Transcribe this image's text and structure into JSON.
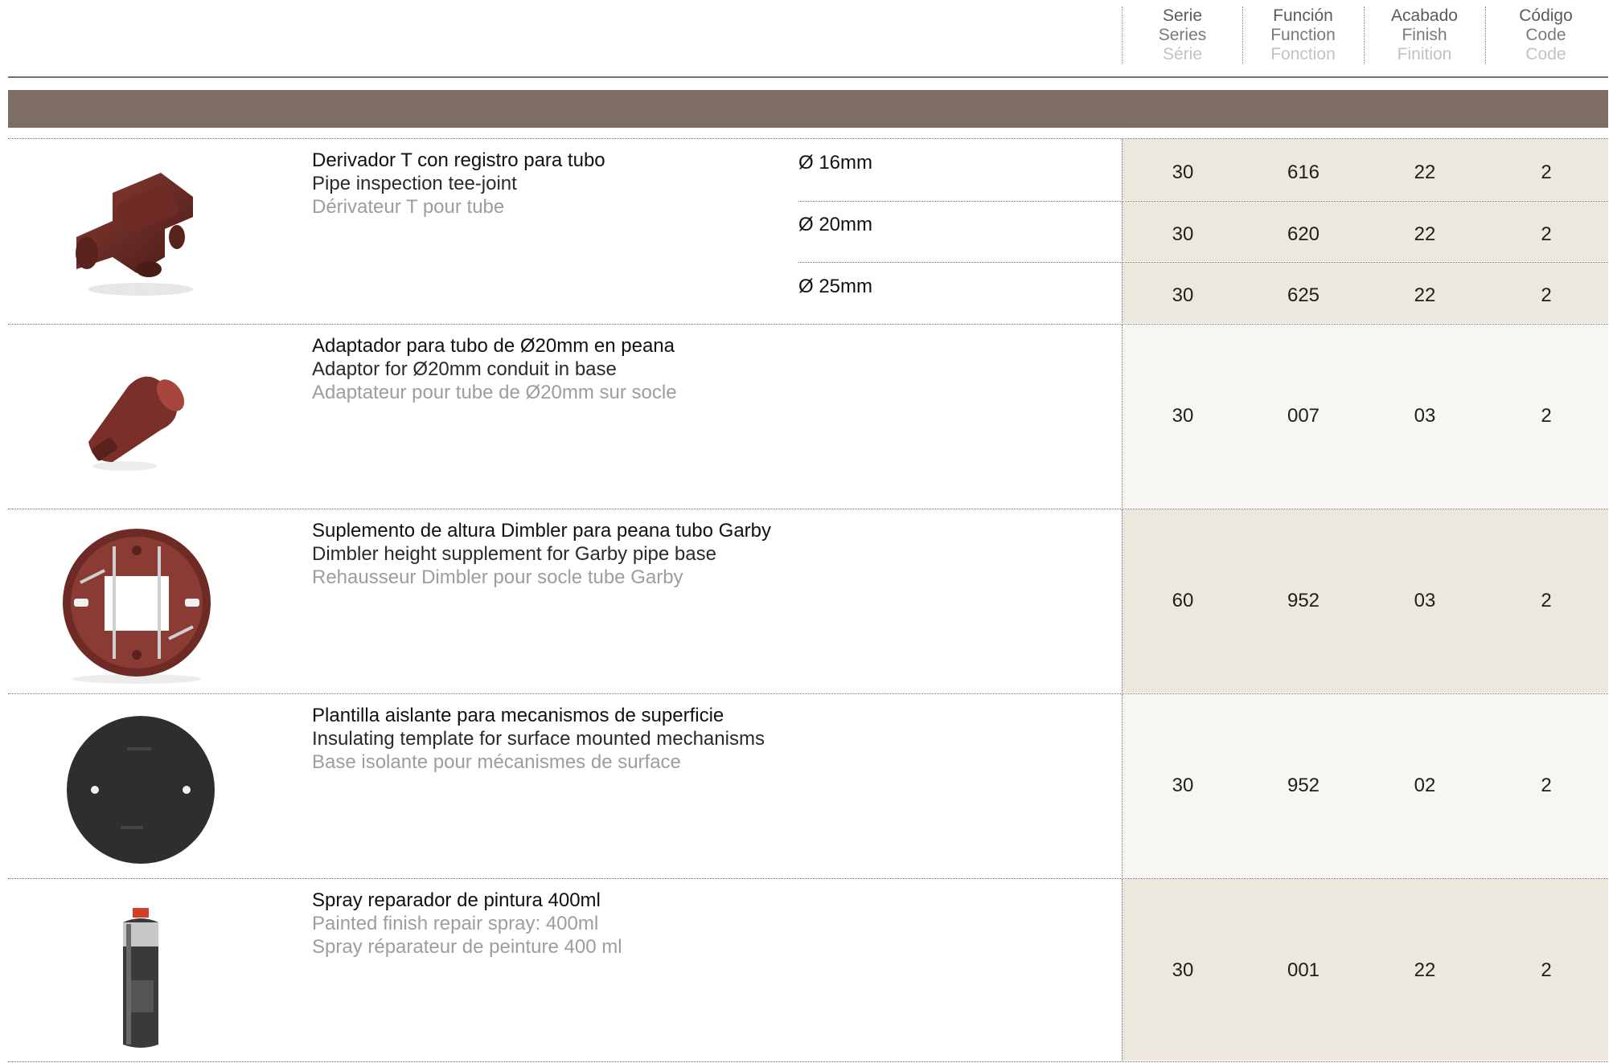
{
  "header": {
    "columns": [
      {
        "l1": "Serie",
        "l2": "Series",
        "l3": "Série"
      },
      {
        "l1": "Función",
        "l2": "Function",
        "l3": "Fonction"
      },
      {
        "l1": "Acabado",
        "l2": "Finish",
        "l3": "Finition"
      },
      {
        "l1": "Código",
        "l2": "Code",
        "l3": "Code"
      }
    ]
  },
  "products": [
    {
      "es": "Derivador T con registro para tubo",
      "en": "Pipe inspection tee-joint",
      "fr": "Dérivateur T pour tube",
      "image": "tee-joint-icon",
      "variants": [
        {
          "diameter": "Ø 16mm",
          "serie": "30",
          "funcion": "616",
          "acabado": "22",
          "codigo": "2"
        },
        {
          "diameter": "Ø 20mm",
          "serie": "30",
          "funcion": "620",
          "acabado": "22",
          "codigo": "2"
        },
        {
          "diameter": "Ø 25mm",
          "serie": "30",
          "funcion": "625",
          "acabado": "22",
          "codigo": "2"
        }
      ]
    },
    {
      "es": "Adaptador para tubo de Ø20mm en peana",
      "en": "Adaptor for Ø20mm conduit in base",
      "fr": "Adaptateur pour tube de Ø20mm sur socle",
      "image": "adaptor-icon",
      "serie": "30",
      "funcion": "007",
      "acabado": "03",
      "codigo": "2"
    },
    {
      "es": "Suplemento de altura Dimbler para peana tubo Garby",
      "en": "Dimbler height supplement for Garby pipe base",
      "fr": "Rehausseur Dimbler pour socle tube Garby",
      "image": "height-supplement-icon",
      "serie": "60",
      "funcion": "952",
      "acabado": "03",
      "codigo": "2"
    },
    {
      "es": "Plantilla aislante para mecanismos de superficie",
      "en": "Insulating template for surface mounted mechanisms",
      "fr": "Base isolante pour mécanismes de surface",
      "image": "insulating-template-icon",
      "serie": "30",
      "funcion": "952",
      "acabado": "02",
      "codigo": "2"
    },
    {
      "es": "Spray reparador de pintura 400ml",
      "en": "Painted finish repair spray: 400ml",
      "fr": "Spray réparateur de peinture 400 ml",
      "image": "spray-can-icon",
      "serie": "30",
      "funcion": "001",
      "acabado": "22",
      "codigo": "2"
    }
  ],
  "colors": {
    "band": "#7d6d62",
    "cell_beige": "#ede8de",
    "cell_light": "#f7f6f3"
  }
}
